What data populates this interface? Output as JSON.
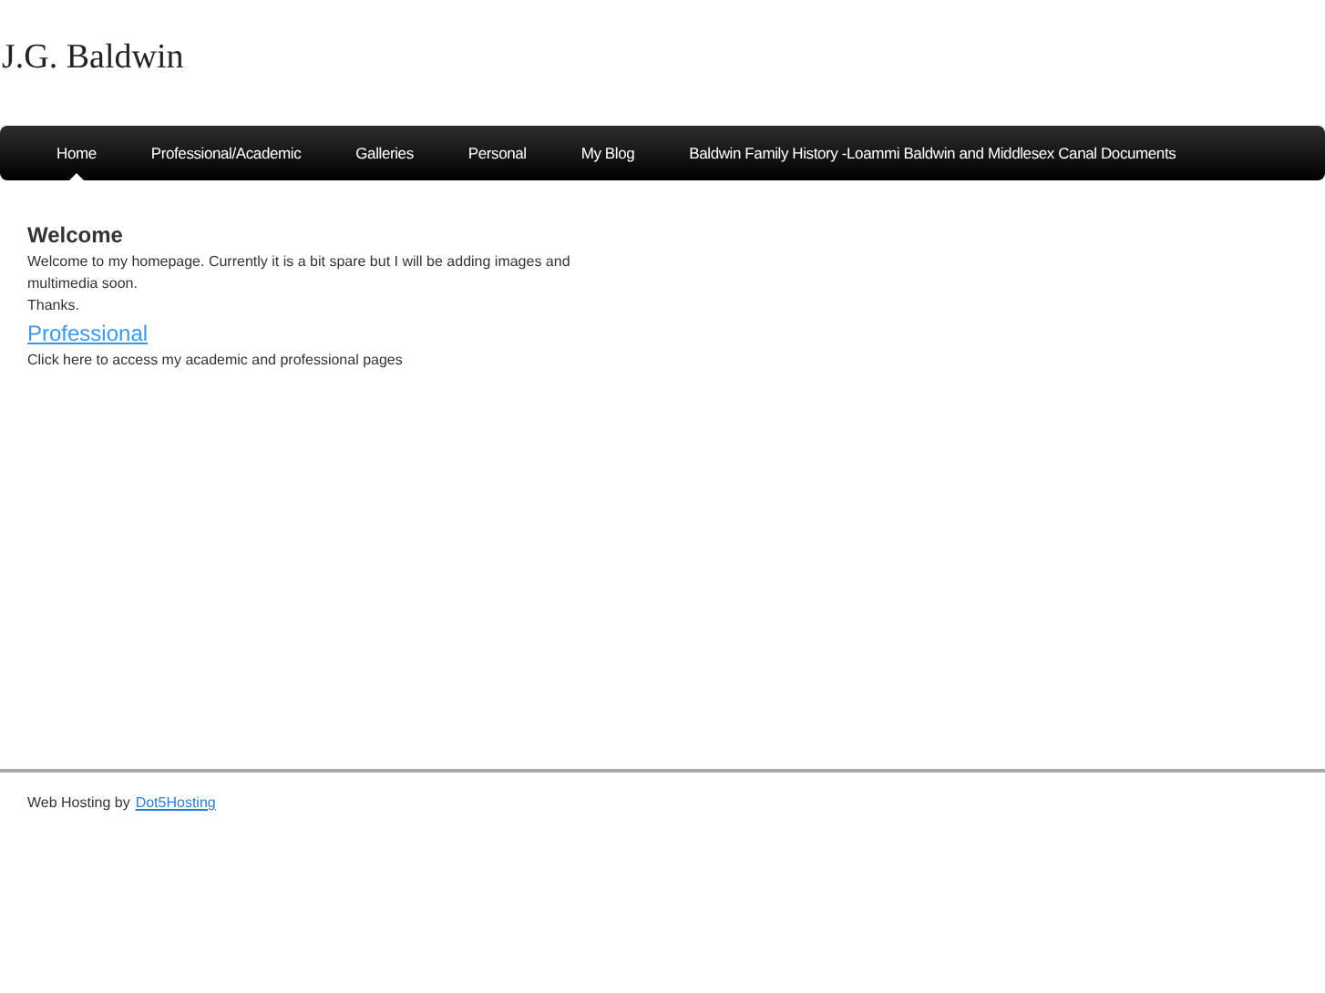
{
  "site_title": "J.G. Baldwin",
  "nav": [
    {
      "label": "Home",
      "selected": true
    },
    {
      "label": "Professional/Academic",
      "selected": false
    },
    {
      "label": "Galleries",
      "selected": false
    },
    {
      "label": "Personal",
      "selected": false
    },
    {
      "label": "My Blog",
      "selected": false
    },
    {
      "label": "Baldwin Family History -Loammi Baldwin and Middlesex Canal Documents",
      "selected": false
    }
  ],
  "content": {
    "heading": "Welcome",
    "intro": "Welcome to my homepage. Currently it is a bit spare but I will be adding images and multimedia soon.",
    "thanks": "Thanks.",
    "link": "Professional",
    "link_caption": "Click here to access my academic and professional pages"
  },
  "footer": {
    "text": "Web Hosting by",
    "link": "Dot5Hosting"
  }
}
